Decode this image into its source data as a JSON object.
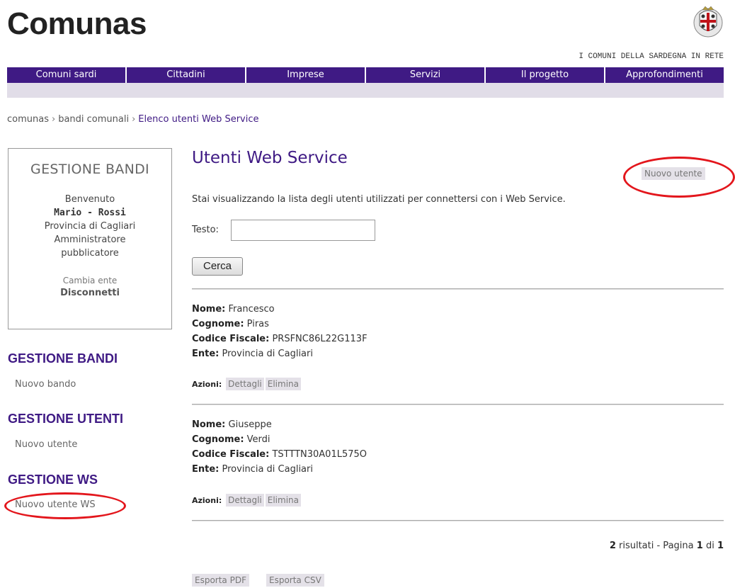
{
  "header": {
    "logo": "Comunas",
    "tagline": "I COMUNI DELLA SARDEGNA IN RETE",
    "crest_icon": "sardinia-coat-of-arms",
    "nav_color": "#3f1a84"
  },
  "nav": [
    "Comuni sardi",
    "Cittadini",
    "Imprese",
    "Servizi",
    "Il progetto",
    "Approfondimenti"
  ],
  "breadcrumb": {
    "items": [
      "comunas",
      "bandi comunali"
    ],
    "current": "Elenco utenti Web Service",
    "separator": "›"
  },
  "sidebar": {
    "box_title": "GESTIONE BANDI",
    "welcome": "Benvenuto",
    "user_name": "Mario - Rossi",
    "ente": "Provincia di Cagliari",
    "role_line1": "Amministratore",
    "role_line2": "pubblicatore",
    "cambia_ente": "Cambia ente",
    "disconnetti": "Disconnetti",
    "sections": [
      {
        "heading": "GESTIONE BANDI",
        "link": "Nuovo bando"
      },
      {
        "heading": "GESTIONE UTENTI",
        "link": "Nuovo utente"
      },
      {
        "heading": "GESTIONE WS",
        "link": "Nuovo utente WS"
      }
    ]
  },
  "main": {
    "title": "Utenti Web Service",
    "new_user_button": "Nuovo utente",
    "intro": "Stai visualizzando la lista degli utenti utilizzati per connettersi con i Web Service.",
    "search_label": "Testo:",
    "search_value": "",
    "search_button": "Cerca",
    "labels": {
      "nome": "Nome:",
      "cognome": "Cognome:",
      "codice_fiscale": "Codice Fiscale:",
      "ente": "Ente:",
      "azioni": "Azioni:",
      "dettagli": "Dettagli",
      "elimina": "Elimina"
    },
    "records": [
      {
        "nome": "Francesco",
        "cognome": "Piras",
        "codice_fiscale": "PRSFNC86L22G113F",
        "ente": "Provincia di Cagliari"
      },
      {
        "nome": "Giuseppe",
        "cognome": "Verdi",
        "codice_fiscale": "TSTTTN30A01L575O",
        "ente": "Provincia di Cagliari"
      }
    ],
    "results": {
      "count": "2",
      "count_suffix": "risultati - Pagina",
      "page": "1",
      "of": "di",
      "total_pages": "1"
    },
    "export_pdf": "Esporta PDF",
    "export_csv": "Esporta CSV"
  },
  "annotation_color": "#e3161c"
}
